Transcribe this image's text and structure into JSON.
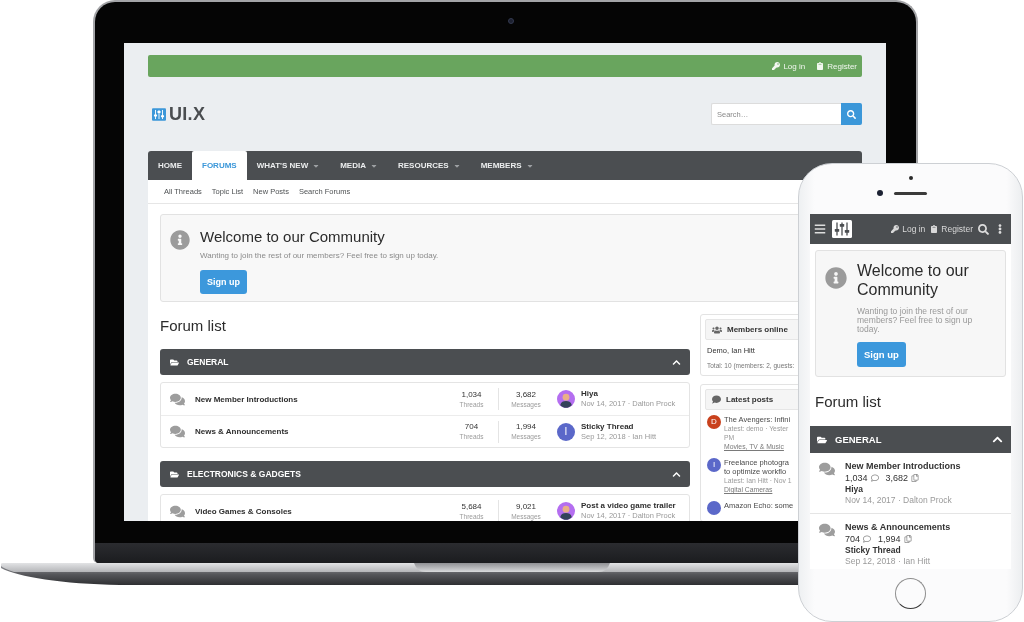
{
  "laptop": {
    "top_bar": {
      "links": [
        {
          "kind": "login",
          "label": "Log in"
        },
        {
          "kind": "register",
          "label": "Register"
        }
      ]
    },
    "logo": {
      "text": "UI.X"
    },
    "search": {
      "placeholder": "Search…"
    },
    "nav": {
      "tabs": [
        {
          "label": "HOME",
          "selected": false,
          "has_menu": false
        },
        {
          "label": "FORUMS",
          "selected": true,
          "has_menu": false
        },
        {
          "label": "WHAT'S NEW",
          "selected": false,
          "has_menu": true
        },
        {
          "label": "MEDIA",
          "selected": false,
          "has_menu": true
        },
        {
          "label": "RESOURCES",
          "selected": false,
          "has_menu": true
        },
        {
          "label": "MEMBERS",
          "selected": false,
          "has_menu": true
        }
      ]
    },
    "subnav": [
      "All Threads",
      "Topic List",
      "New Posts",
      "Search Forums"
    ],
    "notice": {
      "title": "Welcome to our Community",
      "text": "Wanting to join the rest of our members? Feel free to sign up today.",
      "button": "Sign up"
    },
    "forum_list": {
      "title": "Forum list",
      "categories": [
        {
          "name": "GENERAL",
          "expanded": true,
          "forums": [
            {
              "title": "New Member Introductions",
              "threads": "1,034",
              "threads_label": "Threads",
              "messages": "3,682",
              "messages_label": "Messages",
              "last_post": {
                "title": "Hiya",
                "meta": "Nov 14, 2017 · Dalton Prock",
                "avatar": {
                  "kind": "silhouette",
                  "color": "#b46ef0"
                }
              }
            },
            {
              "title": "News & Announcements",
              "threads": "704",
              "threads_label": "Threads",
              "messages": "1,994",
              "messages_label": "Messages",
              "last_post": {
                "title": "Sticky Thread",
                "meta": "Sep 12, 2018 · Ian Hitt",
                "avatar": {
                  "kind": "letter",
                  "letter": "I",
                  "color": "#5b68c9"
                }
              }
            }
          ]
        },
        {
          "name": "ELECTRONICS & GADGETS",
          "expanded": true,
          "forums": [
            {
              "title": "Video Games & Consoles",
              "threads": "5,684",
              "threads_label": "Threads",
              "messages": "9,021",
              "messages_label": "Messages",
              "last_post": {
                "title": "Post a video game trailer",
                "meta": "Nov 14, 2017 · Dalton Prock",
                "avatar": {
                  "kind": "silhouette",
                  "color": "#b46ef0"
                }
              }
            }
          ]
        }
      ]
    },
    "sidebar": {
      "members_online": {
        "title": "Members online",
        "members": "Demo, Ian Hitt",
        "total": "Total: 10 (members: 2, guests:"
      },
      "latest_posts": {
        "title": "Latest posts",
        "items": [
          {
            "letter": "D",
            "color": "#c9411d",
            "title_lines": [
              "The Avengers: Infini"
            ],
            "meta_lines": [
              "Latest: demo · Yester",
              "PM"
            ],
            "forum": "Movies, TV & Music"
          },
          {
            "letter": "I",
            "color": "#5b68c9",
            "title_lines": [
              "Freelance photogra",
              "to optimize workflo"
            ],
            "meta_lines": [
              "Latest: Ian Hitt · Nov 1"
            ],
            "forum": "Digital Cameras"
          },
          {
            "color": "#5b68c9",
            "title_lines": [
              "Amazon Echo: some"
            ]
          }
        ]
      }
    }
  },
  "phone": {
    "header": {
      "links": [
        {
          "kind": "login",
          "label": "Log in"
        },
        {
          "kind": "register",
          "label": "Register"
        }
      ]
    },
    "notice": {
      "title": "Welcome to our Community",
      "text": "Wanting to join the rest of our members? Feel free to sign up today.",
      "button": "Sign up"
    },
    "forum_list": {
      "title": "Forum list",
      "categories": [
        {
          "name": "GENERAL",
          "expanded": true,
          "forums": [
            {
              "title": "New Member Introductions",
              "threads": "1,034",
              "messages": "3,682",
              "last_post_title": "Hiya",
              "meta": "Nov 14, 2017 · Dalton Prock"
            },
            {
              "title": "News & Announcements",
              "threads": "704",
              "messages": "1,994",
              "last_post_title": "Sticky Thread",
              "meta": "Sep 12, 2018 · Ian Hitt"
            }
          ]
        }
      ]
    }
  }
}
